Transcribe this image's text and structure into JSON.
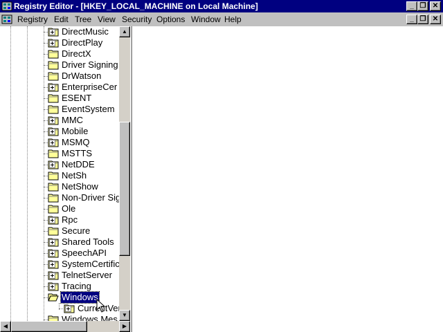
{
  "window": {
    "title": "Registry Editor - [HKEY_LOCAL_MACHINE on Local Machine]",
    "controls": {
      "minimize": "_",
      "maximize": "❐",
      "close": "✕"
    }
  },
  "menubar": {
    "items": [
      "Registry",
      "Edit",
      "Tree",
      "View",
      "Security",
      "Options",
      "Window",
      "Help"
    ],
    "child_controls": {
      "minimize": "_",
      "maximize": "❐",
      "close": "✕"
    }
  },
  "tree": {
    "nodes": [
      {
        "label": "DirectMusic",
        "expandable": true
      },
      {
        "label": "DirectPlay",
        "expandable": true
      },
      {
        "label": "DirectX",
        "expandable": false
      },
      {
        "label": "Driver Signing",
        "expandable": false
      },
      {
        "label": "DrWatson",
        "expandable": false
      },
      {
        "label": "EnterpriseCer",
        "expandable": true
      },
      {
        "label": "ESENT",
        "expandable": false
      },
      {
        "label": "EventSystem",
        "expandable": false
      },
      {
        "label": "MMC",
        "expandable": true
      },
      {
        "label": "Mobile",
        "expandable": true
      },
      {
        "label": "MSMQ",
        "expandable": true
      },
      {
        "label": "MSTTS",
        "expandable": false
      },
      {
        "label": "NetDDE",
        "expandable": true
      },
      {
        "label": "NetSh",
        "expandable": false
      },
      {
        "label": "NetShow",
        "expandable": false
      },
      {
        "label": "Non-Driver Sig",
        "expandable": false
      },
      {
        "label": "Ole",
        "expandable": false
      },
      {
        "label": "Rpc",
        "expandable": true
      },
      {
        "label": "Secure",
        "expandable": false
      },
      {
        "label": "Shared Tools",
        "expandable": true
      },
      {
        "label": "SpeechAPI",
        "expandable": true
      },
      {
        "label": "SystemCertific",
        "expandable": true
      },
      {
        "label": "TelnetServer",
        "expandable": true
      },
      {
        "label": "Tracing",
        "expandable": true
      },
      {
        "label": "Windows",
        "expandable": false,
        "selected": true,
        "open": true
      },
      {
        "label": "CurrentVer",
        "expandable": true,
        "child": true
      },
      {
        "label": "Windows Mes",
        "expandable": false
      }
    ]
  },
  "colors": {
    "titlebar": "#000080",
    "selection": "#000080",
    "chrome": "#c0c0c0",
    "folder": "#ffff99"
  },
  "icons": {
    "app": "registry-editor-icon",
    "folder": "folder-icon",
    "open_folder": "open-folder-icon",
    "expand": "plus-box-icon"
  }
}
